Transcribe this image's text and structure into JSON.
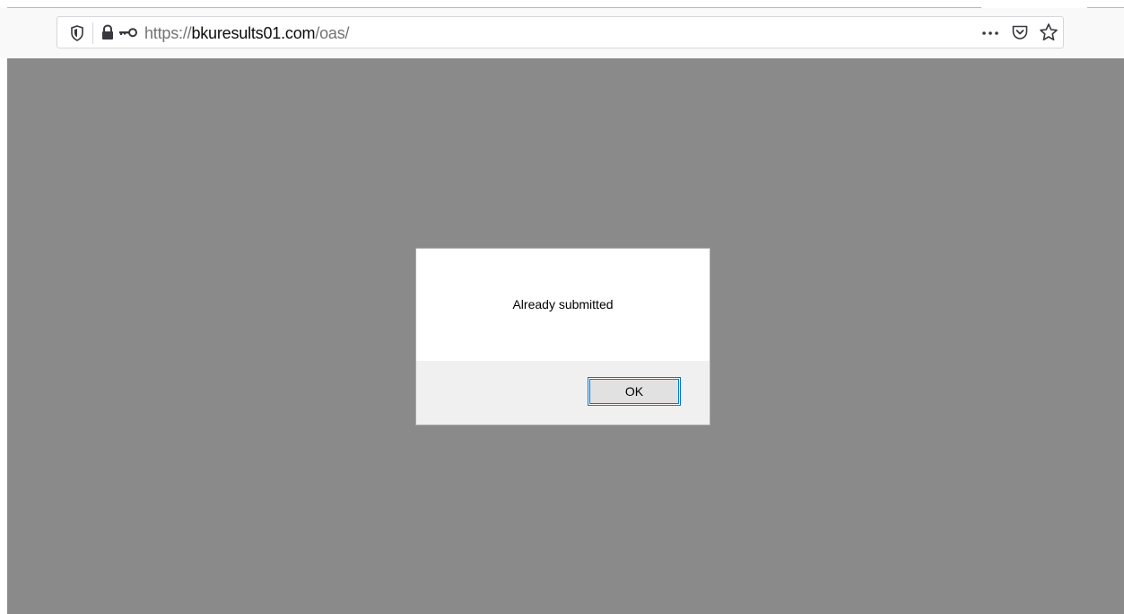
{
  "browser": {
    "url": {
      "scheme": "https://",
      "domain": "bkuresults01.com",
      "path": "/oas/"
    },
    "icons": {
      "tracking_protection": "shield-icon",
      "secure_connection": "lock-icon",
      "permissions": "key-icon",
      "page_actions": "more-icon",
      "save_to_pocket": "pocket-icon",
      "bookmark": "star-icon"
    }
  },
  "page": {
    "overlay_color": "#8a8a8a"
  },
  "dialog": {
    "message": "Already submitted",
    "ok_label": "OK",
    "focus_color": "#0078d7"
  }
}
